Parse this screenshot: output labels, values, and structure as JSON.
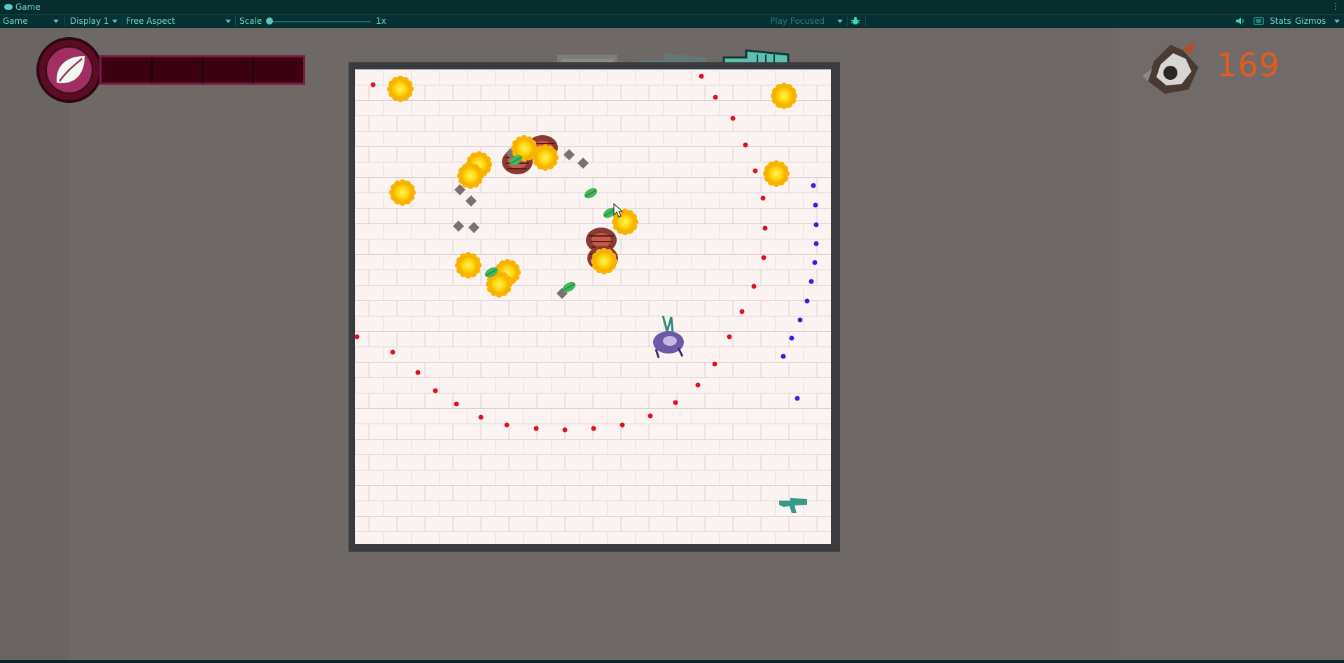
{
  "window": {
    "title": "Game"
  },
  "toolbar": {
    "view_mode": "Game",
    "display": "Display 1",
    "aspect": "Free Aspect",
    "scale_label": "Scale",
    "scale_value": "1x",
    "play_mode": "Play Focused",
    "stats_label": "Stats",
    "gizmos_label": "Gizmos"
  },
  "hud": {
    "score": "169",
    "health_segments_filled": 0,
    "health_segments_total": 4,
    "ability_icon": "leaf-icon",
    "inventory_icons": [
      "safe-icon",
      "gun-icon",
      "gun-icon"
    ]
  },
  "colors": {
    "editor_bg": "#083232",
    "editor_text": "#6ed3d3",
    "viewport_bg": "#6e6866",
    "score_color": "#e55a1f",
    "health_bar": "#3d0010",
    "health_frame": "#7a1a44",
    "bullet_red": "#e01020",
    "bullet_blue": "#3020e0"
  }
}
